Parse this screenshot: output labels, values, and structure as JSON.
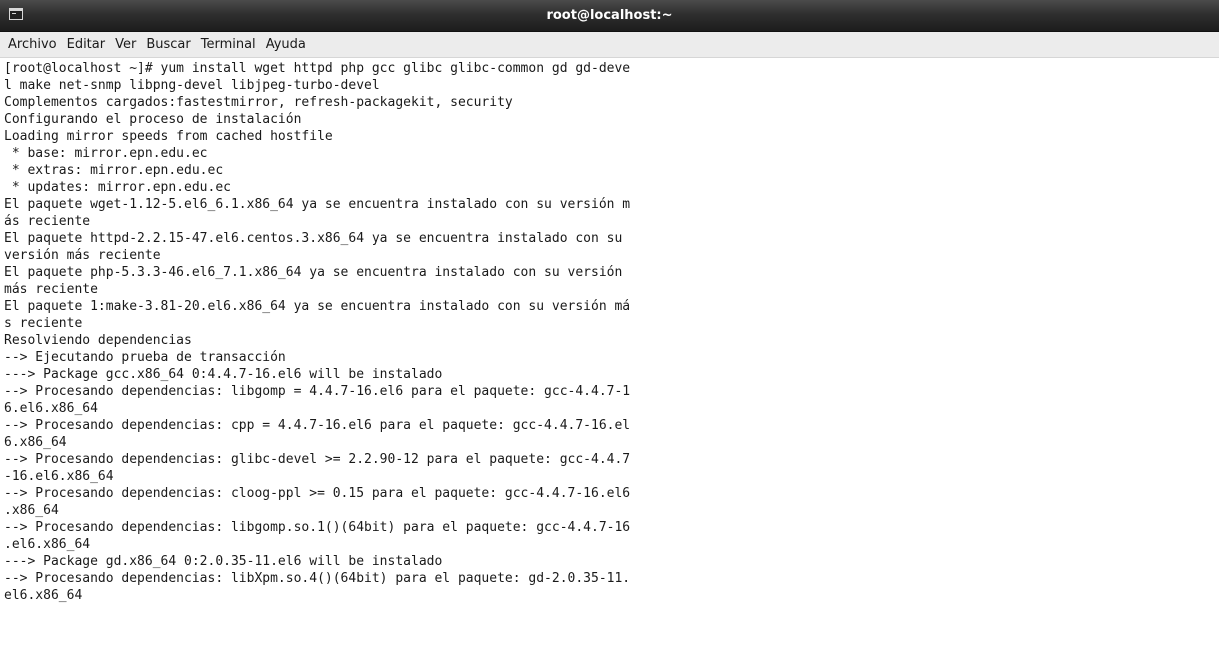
{
  "window": {
    "title": "root@localhost:~"
  },
  "menu": {
    "items": [
      "Archivo",
      "Editar",
      "Ver",
      "Buscar",
      "Terminal",
      "Ayuda"
    ]
  },
  "terminal": {
    "lines": [
      "[root@localhost ~]# yum install wget httpd php gcc glibc glibc-common gd gd-deve",
      "l make net-snmp libpng-devel libjpeg-turbo-devel",
      "Complementos cargados:fastestmirror, refresh-packagekit, security",
      "Configurando el proceso de instalación",
      "Loading mirror speeds from cached hostfile",
      " * base: mirror.epn.edu.ec",
      " * extras: mirror.epn.edu.ec",
      " * updates: mirror.epn.edu.ec",
      "El paquete wget-1.12-5.el6_6.1.x86_64 ya se encuentra instalado con su versión m",
      "ás reciente",
      "El paquete httpd-2.2.15-47.el6.centos.3.x86_64 ya se encuentra instalado con su",
      "versión más reciente",
      "El paquete php-5.3.3-46.el6_7.1.x86_64 ya se encuentra instalado con su versión",
      "más reciente",
      "El paquete 1:make-3.81-20.el6.x86_64 ya se encuentra instalado con su versión má",
      "s reciente",
      "Resolviendo dependencias",
      "--> Ejecutando prueba de transacción",
      "---> Package gcc.x86_64 0:4.4.7-16.el6 will be instalado",
      "--> Procesando dependencias: libgomp = 4.4.7-16.el6 para el paquete: gcc-4.4.7-1",
      "6.el6.x86_64",
      "--> Procesando dependencias: cpp = 4.4.7-16.el6 para el paquete: gcc-4.4.7-16.el",
      "6.x86_64",
      "--> Procesando dependencias: glibc-devel >= 2.2.90-12 para el paquete: gcc-4.4.7",
      "-16.el6.x86_64",
      "--> Procesando dependencias: cloog-ppl >= 0.15 para el paquete: gcc-4.4.7-16.el6",
      ".x86_64",
      "--> Procesando dependencias: libgomp.so.1()(64bit) para el paquete: gcc-4.4.7-16",
      ".el6.x86_64",
      "---> Package gd.x86_64 0:2.0.35-11.el6 will be instalado",
      "--> Procesando dependencias: libXpm.so.4()(64bit) para el paquete: gd-2.0.35-11.",
      "el6.x86_64"
    ]
  }
}
